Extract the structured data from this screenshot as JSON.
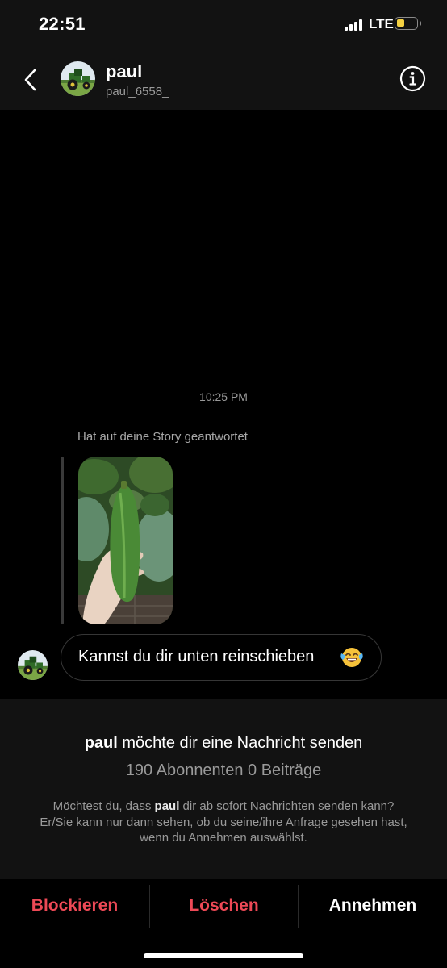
{
  "status_bar": {
    "time": "22:51",
    "carrier": "LTE"
  },
  "header": {
    "name": "paul",
    "username": "paul_6558_"
  },
  "conversation": {
    "timestamp": "10:25 PM",
    "story_reply_note": "Hat auf deine Story geantwortet",
    "message_text": "Kannst du dir unten reinschieben",
    "message_emoji": "face-with-tears-of-joy-icon"
  },
  "request": {
    "name": "paul",
    "title_suffix": " möchte dir eine Nachricht senden",
    "stats": "190 Abonnenten 0 Beiträge",
    "desc_before": "Möchtest du, dass ",
    "desc_name": "paul",
    "desc_after": " dir ab sofort Nachrichten senden kann? Er/Sie kann nur dann sehen, ob du seine/ihre Anfrage gesehen hast, wenn du Annehmen auswählst."
  },
  "actions": {
    "block": "Blockieren",
    "delete": "Löschen",
    "accept": "Annehmen"
  },
  "colors": {
    "destructive": "#ed4956",
    "background": "#000000",
    "panel": "#121212",
    "secondary_text": "#9a9a9a",
    "battery": "#f5d142"
  }
}
